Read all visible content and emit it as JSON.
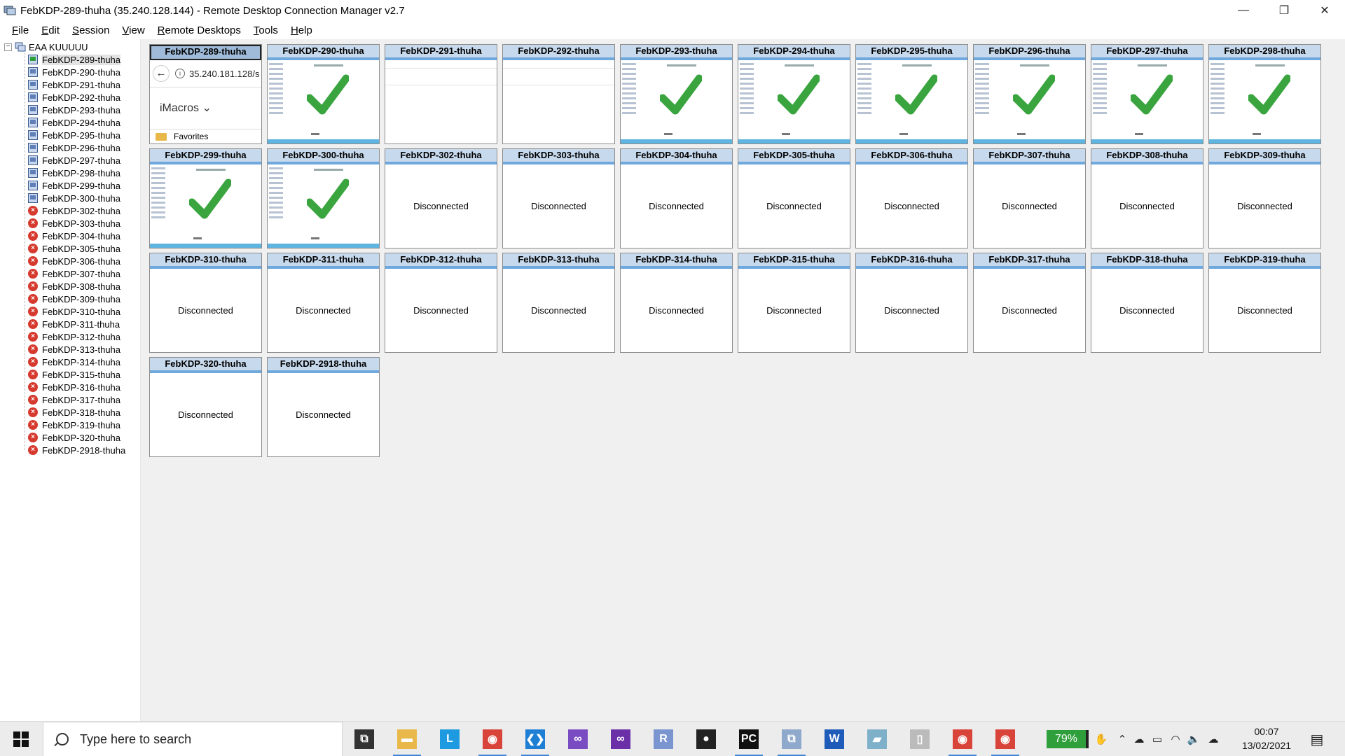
{
  "window": {
    "title": "FebKDP-289-thuha (35.240.128.144) - Remote Desktop Connection Manager v2.7",
    "controls": [
      "—",
      "❐",
      "✕"
    ]
  },
  "menu": [
    {
      "label": "File",
      "mnemonic": "F",
      "rest": "ile"
    },
    {
      "label": "Edit",
      "mnemonic": "E",
      "rest": "dit"
    },
    {
      "label": "Session",
      "mnemonic": "S",
      "rest": "ession"
    },
    {
      "label": "View",
      "mnemonic": "V",
      "rest": "iew"
    },
    {
      "label": "Remote Desktops",
      "mnemonic": "R",
      "rest": "emote Desktops"
    },
    {
      "label": "Tools",
      "mnemonic": "T",
      "rest": "ools"
    },
    {
      "label": "Help",
      "mnemonic": "H",
      "rest": "elp"
    }
  ],
  "tree": {
    "expander": "−",
    "root": "EAA KUUUUU",
    "items": [
      {
        "label": "FebKDP-289-thuha",
        "status": "connected-selected"
      },
      {
        "label": "FebKDP-290-thuha",
        "status": "connected"
      },
      {
        "label": "FebKDP-291-thuha",
        "status": "connected"
      },
      {
        "label": "FebKDP-292-thuha",
        "status": "connected"
      },
      {
        "label": "FebKDP-293-thuha",
        "status": "connected"
      },
      {
        "label": "FebKDP-294-thuha",
        "status": "connected"
      },
      {
        "label": "FebKDP-295-thuha",
        "status": "connected"
      },
      {
        "label": "FebKDP-296-thuha",
        "status": "connected"
      },
      {
        "label": "FebKDP-297-thuha",
        "status": "connected"
      },
      {
        "label": "FebKDP-298-thuha",
        "status": "connected"
      },
      {
        "label": "FebKDP-299-thuha",
        "status": "connected"
      },
      {
        "label": "FebKDP-300-thuha",
        "status": "connected"
      },
      {
        "label": "FebKDP-302-thuha",
        "status": "error"
      },
      {
        "label": "FebKDP-303-thuha",
        "status": "error"
      },
      {
        "label": "FebKDP-304-thuha",
        "status": "error"
      },
      {
        "label": "FebKDP-305-thuha",
        "status": "error"
      },
      {
        "label": "FebKDP-306-thuha",
        "status": "error"
      },
      {
        "label": "FebKDP-307-thuha",
        "status": "error"
      },
      {
        "label": "FebKDP-308-thuha",
        "status": "error"
      },
      {
        "label": "FebKDP-309-thuha",
        "status": "error"
      },
      {
        "label": "FebKDP-310-thuha",
        "status": "error"
      },
      {
        "label": "FebKDP-311-thuha",
        "status": "error"
      },
      {
        "label": "FebKDP-312-thuha",
        "status": "error"
      },
      {
        "label": "FebKDP-313-thuha",
        "status": "error"
      },
      {
        "label": "FebKDP-314-thuha",
        "status": "error"
      },
      {
        "label": "FebKDP-315-thuha",
        "status": "error"
      },
      {
        "label": "FebKDP-316-thuha",
        "status": "error"
      },
      {
        "label": "FebKDP-317-thuha",
        "status": "error"
      },
      {
        "label": "FebKDP-318-thuha",
        "status": "error"
      },
      {
        "label": "FebKDP-319-thuha",
        "status": "error"
      },
      {
        "label": "FebKDP-320-thuha",
        "status": "error"
      },
      {
        "label": "FebKDP-2918-thuha",
        "status": "error"
      }
    ]
  },
  "tiles": [
    {
      "title": "FebKDP-289-thuha",
      "state": "browser",
      "active": true
    },
    {
      "title": "FebKDP-290-thuha",
      "state": "check"
    },
    {
      "title": "FebKDP-291-thuha",
      "state": "blank"
    },
    {
      "title": "FebKDP-292-thuha",
      "state": "blank"
    },
    {
      "title": "FebKDP-293-thuha",
      "state": "check"
    },
    {
      "title": "FebKDP-294-thuha",
      "state": "check"
    },
    {
      "title": "FebKDP-295-thuha",
      "state": "check"
    },
    {
      "title": "FebKDP-296-thuha",
      "state": "check"
    },
    {
      "title": "FebKDP-297-thuha",
      "state": "check"
    },
    {
      "title": "FebKDP-298-thuha",
      "state": "check"
    },
    {
      "title": "FebKDP-299-thuha",
      "state": "check"
    },
    {
      "title": "FebKDP-300-thuha",
      "state": "check"
    },
    {
      "title": "FebKDP-302-thuha",
      "state": "disconnected"
    },
    {
      "title": "FebKDP-303-thuha",
      "state": "disconnected"
    },
    {
      "title": "FebKDP-304-thuha",
      "state": "disconnected"
    },
    {
      "title": "FebKDP-305-thuha",
      "state": "disconnected"
    },
    {
      "title": "FebKDP-306-thuha",
      "state": "disconnected"
    },
    {
      "title": "FebKDP-307-thuha",
      "state": "disconnected"
    },
    {
      "title": "FebKDP-308-thuha",
      "state": "disconnected"
    },
    {
      "title": "FebKDP-309-thuha",
      "state": "disconnected"
    },
    {
      "title": "FebKDP-310-thuha",
      "state": "disconnected"
    },
    {
      "title": "FebKDP-311-thuha",
      "state": "disconnected"
    },
    {
      "title": "FebKDP-312-thuha",
      "state": "disconnected"
    },
    {
      "title": "FebKDP-313-thuha",
      "state": "disconnected"
    },
    {
      "title": "FebKDP-314-thuha",
      "state": "disconnected"
    },
    {
      "title": "FebKDP-315-thuha",
      "state": "disconnected"
    },
    {
      "title": "FebKDP-316-thuha",
      "state": "disconnected"
    },
    {
      "title": "FebKDP-317-thuha",
      "state": "disconnected"
    },
    {
      "title": "FebKDP-318-thuha",
      "state": "disconnected"
    },
    {
      "title": "FebKDP-319-thuha",
      "state": "disconnected"
    },
    {
      "title": "FebKDP-320-thuha",
      "state": "disconnected"
    },
    {
      "title": "FebKDP-2918-thuha",
      "state": "disconnected"
    }
  ],
  "disconnected_text": "Disconnected",
  "browser_tile": {
    "url": "35.240.181.128/s",
    "info_glyph": "i",
    "back_glyph": "←",
    "extension": "iMacros ⌄",
    "bookmark": "Favorites"
  },
  "colors": {
    "check": "#3aa53f",
    "error": "#d63a2f",
    "tile_header": "#c7d9ec",
    "selected_header": "#9fbbd9"
  },
  "taskbar": {
    "search_placeholder": "Type here to search",
    "apps": [
      {
        "name": "task-view",
        "glyph": "⧉",
        "color": "#333333",
        "running": false
      },
      {
        "name": "file-explorer",
        "glyph": "▬",
        "color": "#e8b94a",
        "running": true
      },
      {
        "name": "l-app",
        "glyph": "L",
        "color": "#1e9be0",
        "running": false
      },
      {
        "name": "chrome",
        "glyph": "◉",
        "color": "#d9443a",
        "running": true
      },
      {
        "name": "vscode",
        "glyph": "❮❯",
        "color": "#1f7fd4",
        "running": true
      },
      {
        "name": "visual-studio",
        "glyph": "∞",
        "color": "#7a4cc2",
        "running": false
      },
      {
        "name": "visual-studio-2",
        "glyph": "∞",
        "color": "#6b2fa8",
        "running": false
      },
      {
        "name": "r-app",
        "glyph": "R",
        "color": "#7b95d0",
        "running": false
      },
      {
        "name": "github",
        "glyph": "●",
        "color": "#222222",
        "running": false
      },
      {
        "name": "pycharm",
        "glyph": "PC",
        "color": "#111111",
        "running": true
      },
      {
        "name": "rdcman",
        "glyph": "⧉",
        "color": "#8fa9cc",
        "running": true
      },
      {
        "name": "word",
        "glyph": "W",
        "color": "#1f5bb8",
        "running": false
      },
      {
        "name": "notepad",
        "glyph": "▰",
        "color": "#7fb0c9",
        "running": false
      },
      {
        "name": "file",
        "glyph": "▯",
        "color": "#bbbbbb",
        "running": false
      },
      {
        "name": "chrome-2",
        "glyph": "◉",
        "color": "#d9443a",
        "running": true
      },
      {
        "name": "chrome-3",
        "glyph": "◉",
        "color": "#d9443a",
        "running": true
      }
    ],
    "battery_label": "79%",
    "tray_icons": [
      {
        "name": "pen-icon",
        "glyph": "✋"
      },
      {
        "name": "chevron-up-icon",
        "glyph": "⌃"
      },
      {
        "name": "cloud-icon",
        "glyph": "☁"
      },
      {
        "name": "battery-icon",
        "glyph": "▭"
      },
      {
        "name": "wifi-icon",
        "glyph": "◠"
      },
      {
        "name": "volume-icon",
        "glyph": "🔈"
      },
      {
        "name": "onedrive-icon",
        "glyph": "☁"
      }
    ],
    "time": "00:07",
    "date": "13/02/2021",
    "notification_glyph": "▤"
  }
}
